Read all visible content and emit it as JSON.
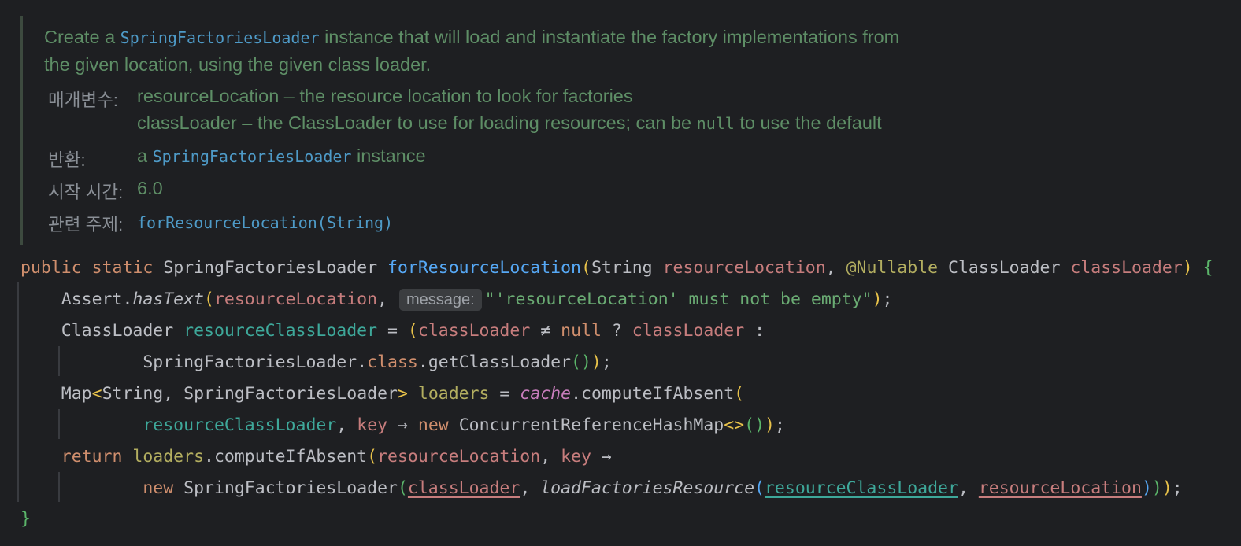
{
  "javadoc": {
    "desc_1": "Create a ",
    "desc_ref": "SpringFactoriesLoader",
    "desc_2": " instance that will load and instantiate the factory implementations from",
    "desc_3": "the given location, using the given class loader.",
    "params_label": "매개변수:",
    "param1": "resourceLocation – the resource location to look for factories",
    "param2_a": "classLoader – the ClassLoader to use for loading resources; can be ",
    "param2_code": "null",
    "param2_b": " to use the default",
    "returns_label": "반환:",
    "returns_a": "a ",
    "returns_ref": "SpringFactoriesLoader",
    "returns_b": " instance",
    "since_label": "시작 시간:",
    "since_value": "6.0",
    "see_label": "관련 주제:",
    "see_value": "forResourceLocation(String)"
  },
  "code": {
    "l1": {
      "public": "public",
      "static": "static",
      "ret": "SpringFactoriesLoader",
      "method": "forResourceLocation",
      "p1_type": "String",
      "p1": "resourceLocation",
      "ann": "@Nullable",
      "p2_type": "ClassLoader",
      "p2": "classLoader"
    },
    "l2": {
      "assert": "Assert.",
      "hasText": "hasText",
      "arg": "resourceLocation",
      "hint": "message:",
      "str": "\"'resourceLocation' must not be empty\""
    },
    "l3": {
      "type": "ClassLoader",
      "var": "resourceClassLoader",
      "cond": "classLoader",
      "ne": "≠",
      "null": "null",
      "alt": "classLoader"
    },
    "l4": {
      "cls": "SpringFactoriesLoader.",
      "kw": "class",
      "call": ".getClassLoader"
    },
    "l5": {
      "map": "Map",
      "g1": "String",
      "g2": "SpringFactoriesLoader",
      "var": "loaders",
      "cache": "cache",
      "call": ".computeIfAbsent"
    },
    "l6": {
      "arg": "resourceClassLoader",
      "key": "key",
      "arrow": "→",
      "new": "new",
      "type": "ConcurrentReferenceHashMap"
    },
    "l7": {
      "return": "return",
      "var": "loaders",
      "call": ".computeIfAbsent",
      "arg": "resourceLocation",
      "key": "key",
      "arrow": "→"
    },
    "l8": {
      "new": "new",
      "type": "SpringFactoriesLoader",
      "a1": "classLoader",
      "fn": "loadFactoriesResource",
      "a2": "resourceClassLoader",
      "a3": "resourceLocation"
    },
    "l9": {
      "close": "}"
    }
  }
}
